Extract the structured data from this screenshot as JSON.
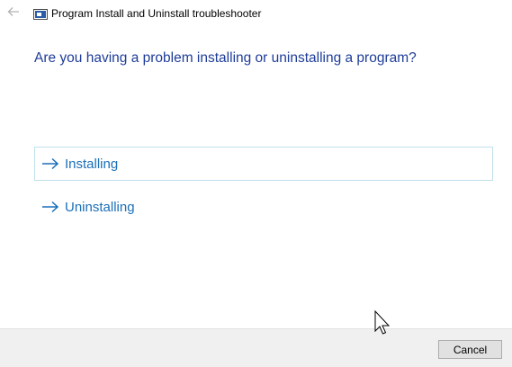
{
  "window": {
    "title": "Program Install and Uninstall troubleshooter",
    "back_icon": "back-arrow-icon",
    "app_icon": "troubleshooter-icon"
  },
  "main": {
    "question": "Are you having a problem installing or uninstalling a program?",
    "options": [
      {
        "label": "Installing",
        "icon": "arrow-right-icon",
        "highlighted": true
      },
      {
        "label": "Uninstalling",
        "icon": "arrow-right-icon",
        "highlighted": false
      }
    ]
  },
  "footer": {
    "cancel_label": "Cancel"
  },
  "colors": {
    "question_text": "#1f3d99",
    "option_text": "#1a6fb8",
    "option_hover_border": "#bfe0eb",
    "footer_bg": "#f0f0f0"
  }
}
